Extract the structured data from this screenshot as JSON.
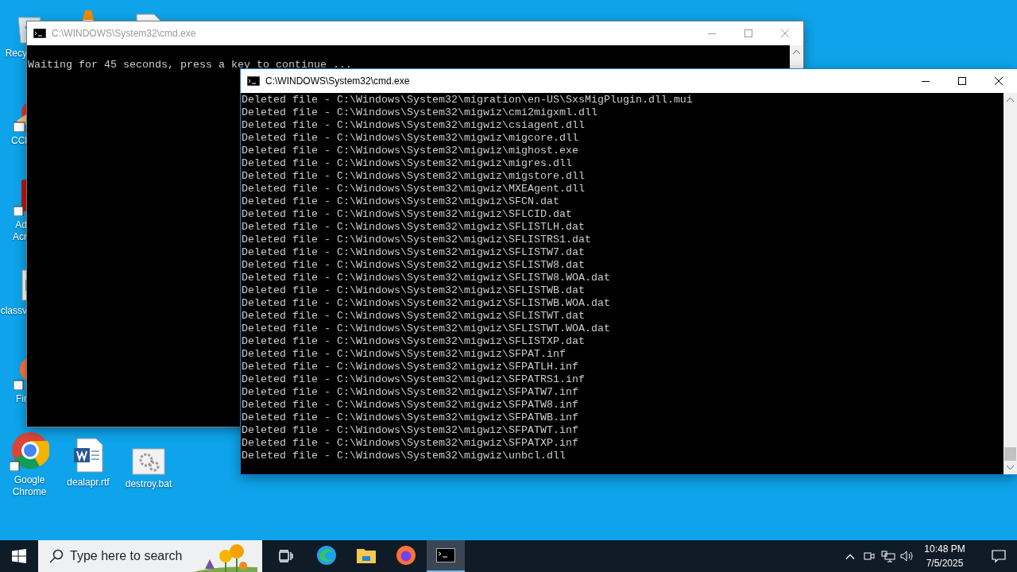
{
  "desktop": {
    "icons": [
      {
        "kind": "recycle-bin",
        "label": [
          "Recy"
        ]
      },
      {
        "kind": "vlc"
      },
      {
        "kind": "document"
      },
      {
        "kind": "ccleaner",
        "label": [
          "CCl"
        ]
      },
      {
        "kind": "acrobat",
        "label": [
          "Ad",
          "Acr"
        ]
      },
      {
        "kind": "image-file",
        "label": [
          "classv"
        ]
      },
      {
        "kind": "firefox",
        "label": [
          "Fir"
        ]
      },
      {
        "kind": "chrome",
        "label": [
          "Google",
          "Chrome"
        ]
      },
      {
        "kind": "word",
        "label": [
          "dealapr.rtf"
        ]
      },
      {
        "kind": "batch",
        "label": [
          "destroy.bat"
        ]
      }
    ]
  },
  "windows": [
    {
      "title": "C:\\WINDOWS\\System32\\cmd.exe",
      "active": false,
      "lines": [
        "Waiting for 45 seconds, press a key to continue ..."
      ]
    },
    {
      "title": "C:\\WINDOWS\\System32\\cmd.exe",
      "active": true,
      "lines": [
        "Deleted file - C:\\Windows\\System32\\migration\\en-US\\SxsMigPlugin.dll.mui",
        "Deleted file - C:\\Windows\\System32\\migwiz\\cmi2migxml.dll",
        "Deleted file - C:\\Windows\\System32\\migwiz\\csiagent.dll",
        "Deleted file - C:\\Windows\\System32\\migwiz\\migcore.dll",
        "Deleted file - C:\\Windows\\System32\\migwiz\\mighost.exe",
        "Deleted file - C:\\Windows\\System32\\migwiz\\migres.dll",
        "Deleted file - C:\\Windows\\System32\\migwiz\\migstore.dll",
        "Deleted file - C:\\Windows\\System32\\migwiz\\MXEAgent.dll",
        "Deleted file - C:\\Windows\\System32\\migwiz\\SFCN.dat",
        "Deleted file - C:\\Windows\\System32\\migwiz\\SFLCID.dat",
        "Deleted file - C:\\Windows\\System32\\migwiz\\SFLISTLH.dat",
        "Deleted file - C:\\Windows\\System32\\migwiz\\SFLISTRS1.dat",
        "Deleted file - C:\\Windows\\System32\\migwiz\\SFLISTW7.dat",
        "Deleted file - C:\\Windows\\System32\\migwiz\\SFLISTW8.dat",
        "Deleted file - C:\\Windows\\System32\\migwiz\\SFLISTW8.WOA.dat",
        "Deleted file - C:\\Windows\\System32\\migwiz\\SFLISTWB.dat",
        "Deleted file - C:\\Windows\\System32\\migwiz\\SFLISTWB.WOA.dat",
        "Deleted file - C:\\Windows\\System32\\migwiz\\SFLISTWT.dat",
        "Deleted file - C:\\Windows\\System32\\migwiz\\SFLISTWT.WOA.dat",
        "Deleted file - C:\\Windows\\System32\\migwiz\\SFLISTXP.dat",
        "Deleted file - C:\\Windows\\System32\\migwiz\\SFPAT.inf",
        "Deleted file - C:\\Windows\\System32\\migwiz\\SFPATLH.inf",
        "Deleted file - C:\\Windows\\System32\\migwiz\\SFPATRS1.inf",
        "Deleted file - C:\\Windows\\System32\\migwiz\\SFPATW7.inf",
        "Deleted file - C:\\Windows\\System32\\migwiz\\SFPATW8.inf",
        "Deleted file - C:\\Windows\\System32\\migwiz\\SFPATWB.inf",
        "Deleted file - C:\\Windows\\System32\\migwiz\\SFPATWT.inf",
        "Deleted file - C:\\Windows\\System32\\migwiz\\SFPATXP.inf",
        "Deleted file - C:\\Windows\\System32\\migwiz\\unbcl.dll"
      ]
    }
  ],
  "taskbar": {
    "search": {
      "placeholder": "Type here to search"
    },
    "apps": [
      {
        "kind": "edge",
        "selected": false
      },
      {
        "kind": "explorer",
        "selected": false
      },
      {
        "kind": "firefox",
        "selected": false
      },
      {
        "kind": "cmd",
        "selected": true
      }
    ],
    "clock": {
      "time": "10:48 PM",
      "date": "7/5/2025"
    }
  }
}
